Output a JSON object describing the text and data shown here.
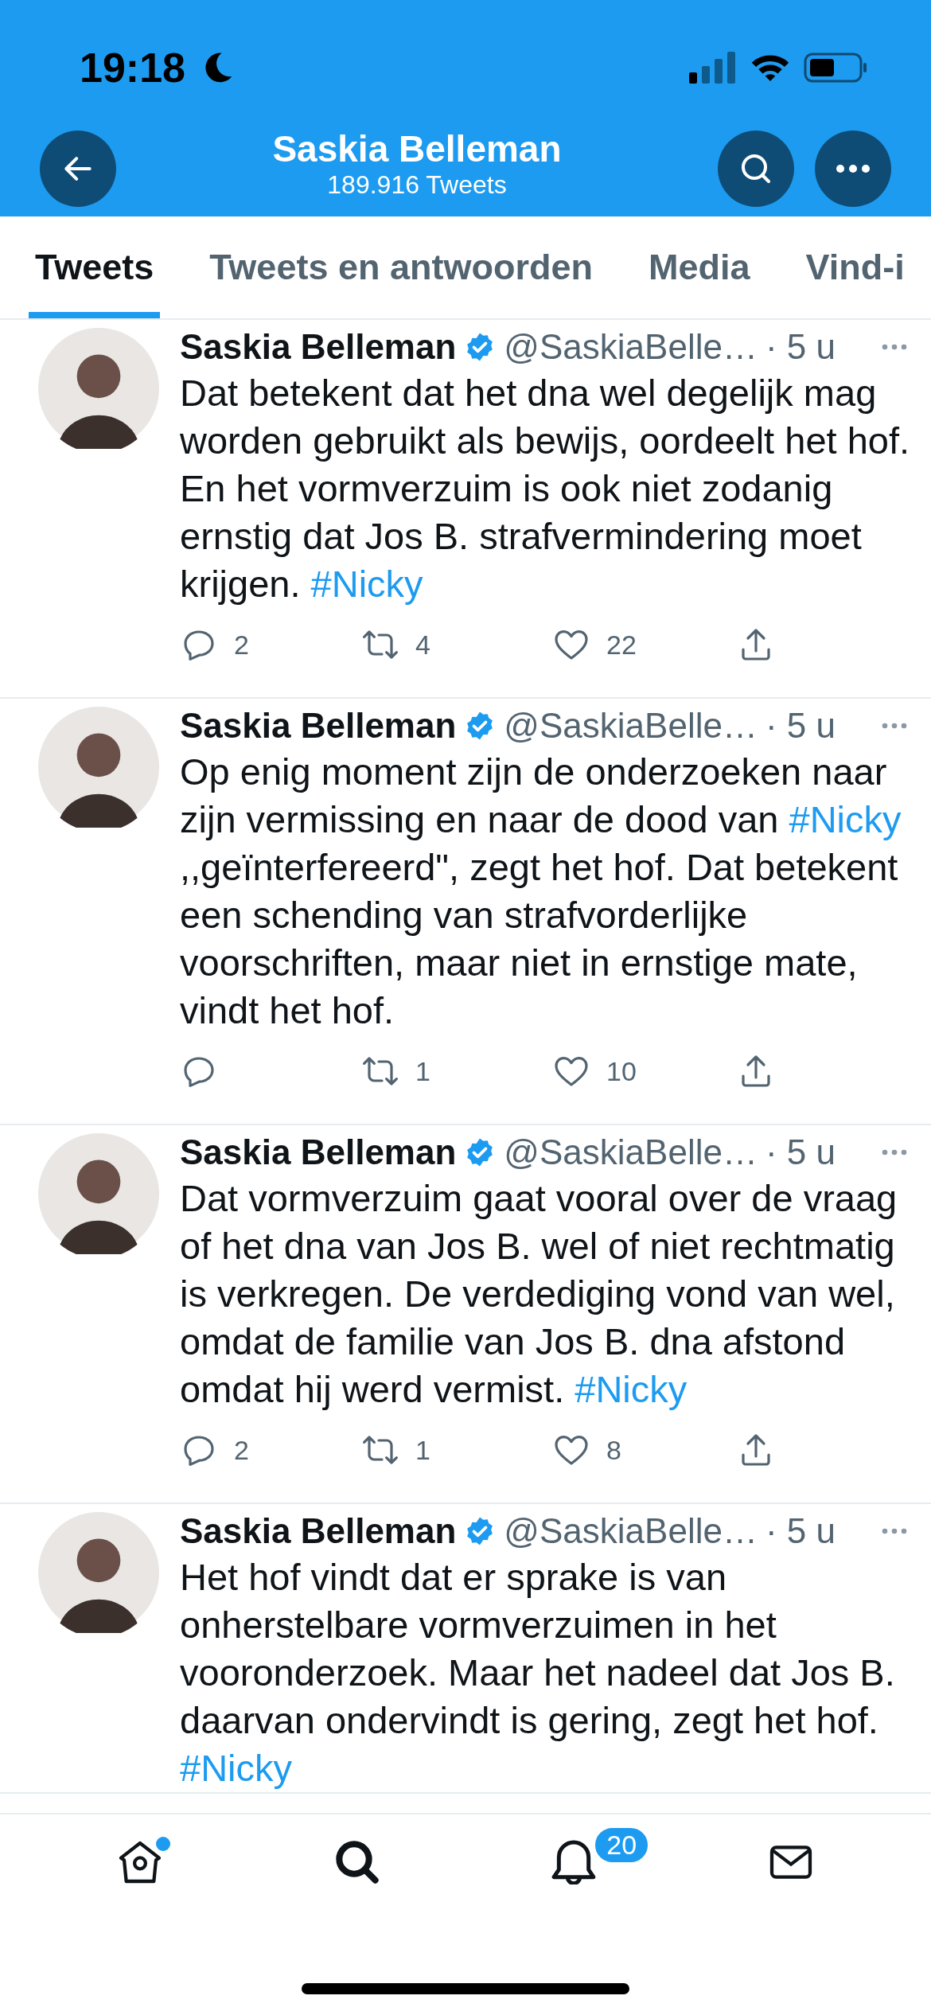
{
  "status_bar": {
    "time": "19:18"
  },
  "header": {
    "title": "Saskia Belleman",
    "subtitle": "189.916 Tweets"
  },
  "tabs": [
    {
      "label": "Tweets",
      "selected": true
    },
    {
      "label": "Tweets en antwoorden",
      "selected": false
    },
    {
      "label": "Media",
      "selected": false
    },
    {
      "label": "Vind-i",
      "selected": false
    }
  ],
  "tweets": [
    {
      "name": "Saskia Belleman",
      "verified": true,
      "handle": "@SaskiaBelle…",
      "time": "· 5 u",
      "segments": [
        {
          "kind": "text",
          "text": "Dat betekent dat het dna wel degelijk mag worden gebruikt als bewijs, oordeelt het hof. En het vormverzuim is ook niet zodanig ernstig dat Jos B. strafvermindering moet krijgen. "
        },
        {
          "kind": "hashtag",
          "text": "#Nicky"
        }
      ],
      "actions": {
        "replies": "2",
        "retweets": "4",
        "likes": "22"
      }
    },
    {
      "name": "Saskia Belleman",
      "verified": true,
      "handle": "@SaskiaBelle…",
      "time": "· 5 u",
      "segments": [
        {
          "kind": "text",
          "text": "Op enig moment zijn de onderzoeken naar zijn vermissing en naar de dood van "
        },
        {
          "kind": "hashtag",
          "text": "#Nicky"
        },
        {
          "kind": "text",
          "text": " ,,geïnterfereerd\", zegt het hof. Dat betekent een schending van strafvorderlijke voorschriften, maar niet in ernstige mate, vindt het hof."
        }
      ],
      "actions": {
        "retweets": "1",
        "likes": "10"
      }
    },
    {
      "name": "Saskia Belleman",
      "verified": true,
      "handle": "@SaskiaBelle…",
      "time": "· 5 u",
      "segments": [
        {
          "kind": "text",
          "text": "Dat vormverzuim gaat vooral over de vraag of het dna van Jos B. wel of niet rechtmatig is verkregen. De verdediging vond van wel, omdat de familie van Jos B. dna afstond omdat hij werd vermist. "
        },
        {
          "kind": "hashtag",
          "text": "#Nicky"
        }
      ],
      "actions": {
        "replies": "2",
        "retweets": "1",
        "likes": "8"
      }
    },
    {
      "name": "Saskia Belleman",
      "verified": true,
      "handle": "@SaskiaBelle…",
      "time": "· 5 u",
      "segments": [
        {
          "kind": "text",
          "text": "Het hof vindt dat er sprake is van onherstelbare vormverzuimen in het vooronderzoek. Maar het nadeel dat Jos B. daarvan ondervindt is gering, zegt het hof. "
        },
        {
          "kind": "hashtag",
          "text": "#Nicky"
        }
      ]
    }
  ],
  "bottom_nav": [
    {
      "kind": "home",
      "selected": false,
      "unread": true
    },
    {
      "kind": "search",
      "selected": true,
      "unread": false
    },
    {
      "kind": "notifications",
      "selected": false,
      "unread": false,
      "badge": "20"
    },
    {
      "kind": "messages",
      "selected": false,
      "unread": false
    }
  ]
}
